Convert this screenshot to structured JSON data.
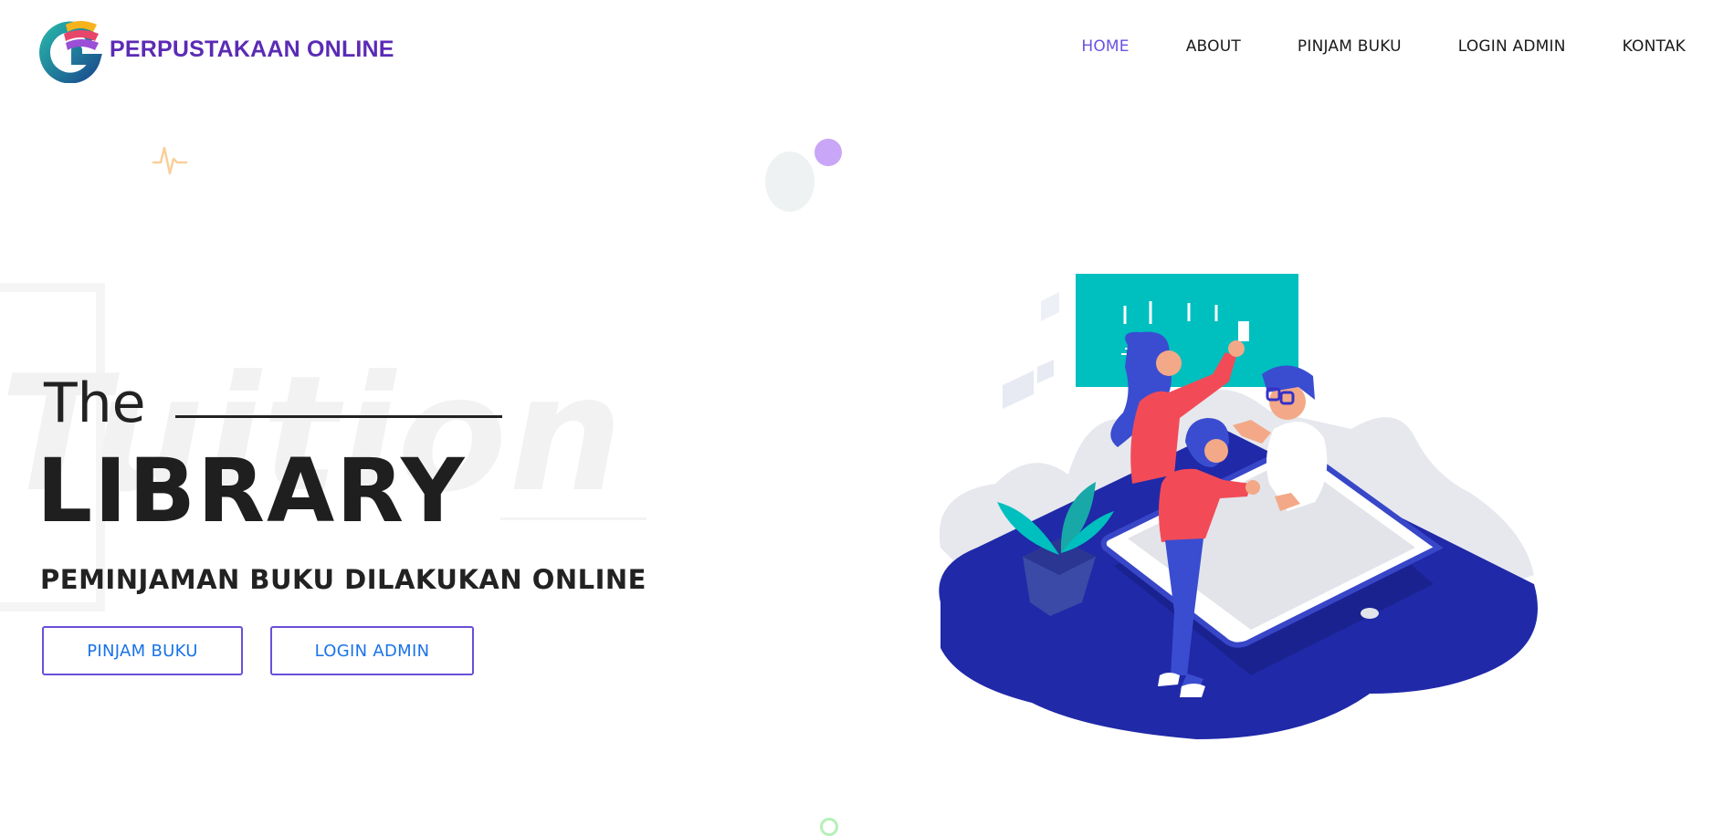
{
  "brand": {
    "name": "PERPUSTAKAAN ONLINE",
    "logo_icon": "library-logo-icon"
  },
  "nav": {
    "items": [
      {
        "label": "HOME",
        "active": true
      },
      {
        "label": "ABOUT",
        "active": false
      },
      {
        "label": "PINJAM BUKU",
        "active": false
      },
      {
        "label": "LOGIN ADMIN",
        "active": false
      },
      {
        "label": "KONTAK",
        "active": false
      }
    ]
  },
  "hero": {
    "background_word": "Tuition",
    "pre_title": "The",
    "title": "LIBRARY",
    "subtitle": "PEMINJAMAN BUKU DILAKUKAN ONLINE",
    "buttons": {
      "primary": "PINJAM BUKU",
      "secondary": "LOGIN ADMIN"
    },
    "illustration": "people-working-at-tablet-illustration"
  },
  "colors": {
    "brand_purple": "#5b2bb5",
    "nav_active": "#6a52e0",
    "button_text": "#1a73e8",
    "button_border": "#6a4fd8",
    "illustration_navy": "#2029a8",
    "illustration_teal": "#00bfbf",
    "illustration_red": "#f24b57"
  }
}
